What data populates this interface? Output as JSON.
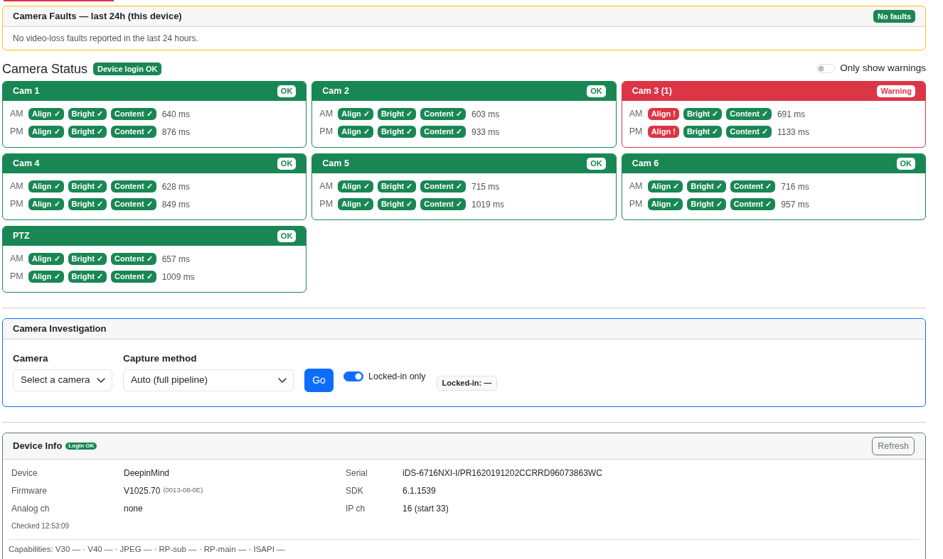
{
  "faults": {
    "title": "Camera Faults — last 24h (this device)",
    "badge": "No faults",
    "message": "No video-loss faults reported in the last 24 hours."
  },
  "camera_status": {
    "title": "Camera Status",
    "login_badge": "Device login OK",
    "warnings_toggle": {
      "label": "Only show warnings",
      "on": false
    }
  },
  "cameras": [
    {
      "name": "Cam 1",
      "warning": false,
      "status": "OK",
      "runs": [
        {
          "period": "AM",
          "checks": [
            {
              "label": "Align ✓",
              "passed": true
            },
            {
              "label": "Bright ✓",
              "passed": true
            },
            {
              "label": "Content ✓",
              "passed": true
            }
          ],
          "time": "640 ms"
        },
        {
          "period": "PM",
          "checks": [
            {
              "label": "Align ✓",
              "passed": true
            },
            {
              "label": "Bright ✓",
              "passed": true
            },
            {
              "label": "Content ✓",
              "passed": true
            }
          ],
          "time": "876 ms"
        }
      ]
    },
    {
      "name": "Cam 2",
      "warning": false,
      "status": "OK",
      "runs": [
        {
          "period": "AM",
          "checks": [
            {
              "label": "Align ✓",
              "passed": true
            },
            {
              "label": "Bright ✓",
              "passed": true
            },
            {
              "label": "Content ✓",
              "passed": true
            }
          ],
          "time": "603 ms"
        },
        {
          "period": "PM",
          "checks": [
            {
              "label": "Align ✓",
              "passed": true
            },
            {
              "label": "Bright ✓",
              "passed": true
            },
            {
              "label": "Content ✓",
              "passed": true
            }
          ],
          "time": "933 ms"
        }
      ]
    },
    {
      "name": "Cam 3 (1)",
      "warning": true,
      "status": "Warning",
      "runs": [
        {
          "period": "AM",
          "checks": [
            {
              "label": "Align !",
              "passed": false
            },
            {
              "label": "Bright ✓",
              "passed": true
            },
            {
              "label": "Content ✓",
              "passed": true
            }
          ],
          "time": "691 ms"
        },
        {
          "period": "PM",
          "checks": [
            {
              "label": "Align !",
              "passed": false
            },
            {
              "label": "Bright ✓",
              "passed": true
            },
            {
              "label": "Content ✓",
              "passed": true
            }
          ],
          "time": "1133 ms"
        }
      ]
    },
    {
      "name": "Cam 4",
      "warning": false,
      "status": "OK",
      "runs": [
        {
          "period": "AM",
          "checks": [
            {
              "label": "Align ✓",
              "passed": true
            },
            {
              "label": "Bright ✓",
              "passed": true
            },
            {
              "label": "Content ✓",
              "passed": true
            }
          ],
          "time": "628 ms"
        },
        {
          "period": "PM",
          "checks": [
            {
              "label": "Align ✓",
              "passed": true
            },
            {
              "label": "Bright ✓",
              "passed": true
            },
            {
              "label": "Content ✓",
              "passed": true
            }
          ],
          "time": "849 ms"
        }
      ]
    },
    {
      "name": "Cam 5",
      "warning": false,
      "status": "OK",
      "runs": [
        {
          "period": "AM",
          "checks": [
            {
              "label": "Align ✓",
              "passed": true
            },
            {
              "label": "Bright ✓",
              "passed": true
            },
            {
              "label": "Content ✓",
              "passed": true
            }
          ],
          "time": "715 ms"
        },
        {
          "period": "PM",
          "checks": [
            {
              "label": "Align ✓",
              "passed": true
            },
            {
              "label": "Bright ✓",
              "passed": true
            },
            {
              "label": "Content ✓",
              "passed": true
            }
          ],
          "time": "1019 ms"
        }
      ]
    },
    {
      "name": "Cam 6",
      "warning": false,
      "status": "OK",
      "runs": [
        {
          "period": "AM",
          "checks": [
            {
              "label": "Align ✓",
              "passed": true
            },
            {
              "label": "Bright ✓",
              "passed": true
            },
            {
              "label": "Content ✓",
              "passed": true
            }
          ],
          "time": "716 ms"
        },
        {
          "period": "PM",
          "checks": [
            {
              "label": "Align ✓",
              "passed": true
            },
            {
              "label": "Bright ✓",
              "passed": true
            },
            {
              "label": "Content ✓",
              "passed": true
            }
          ],
          "time": "957 ms"
        }
      ]
    },
    {
      "name": "PTZ",
      "warning": false,
      "status": "OK",
      "runs": [
        {
          "period": "AM",
          "checks": [
            {
              "label": "Align ✓",
              "passed": true
            },
            {
              "label": "Bright ✓",
              "passed": true
            },
            {
              "label": "Content ✓",
              "passed": true
            }
          ],
          "time": "657 ms"
        },
        {
          "period": "PM",
          "checks": [
            {
              "label": "Align ✓",
              "passed": true
            },
            {
              "label": "Bright ✓",
              "passed": true
            },
            {
              "label": "Content ✓",
              "passed": true
            }
          ],
          "time": "1009 ms"
        }
      ]
    }
  ],
  "investigation": {
    "title": "Camera Investigation",
    "camera": {
      "label": "Camera",
      "value": "Select a camera"
    },
    "capture_method": {
      "label": "Capture method",
      "value": "Auto (full pipeline)"
    },
    "go_button": "Go",
    "locked_toggle": {
      "label": "Locked-in only",
      "on": true
    },
    "locked_badge": "Locked-in: —"
  },
  "device_info": {
    "title": "Device Info",
    "login_badge": "Login OK",
    "refresh_button": "Refresh",
    "rows": [
      {
        "left": {
          "label": "Device",
          "value": "DeepinMind"
        },
        "right": {
          "label": "Serial",
          "value": "iDS-6716NXI-I/PR1620191202CCRRD96073863WC"
        }
      },
      {
        "left": {
          "label": "Firmware",
          "value": "V1025.70",
          "note": "(0013-08-0E)"
        },
        "right": {
          "label": "SDK",
          "value": "6.1.1539"
        }
      },
      {
        "left": {
          "label": "Analog ch",
          "value": "none"
        },
        "right": {
          "label": "IP ch",
          "value": "16 (start 33)"
        }
      }
    ],
    "checked": "Checked 12:53:09",
    "capabilities": "Capabilities: V30 — · V40 — · JPEG — · RP-sub — · RP-main — · ISAPI —"
  }
}
